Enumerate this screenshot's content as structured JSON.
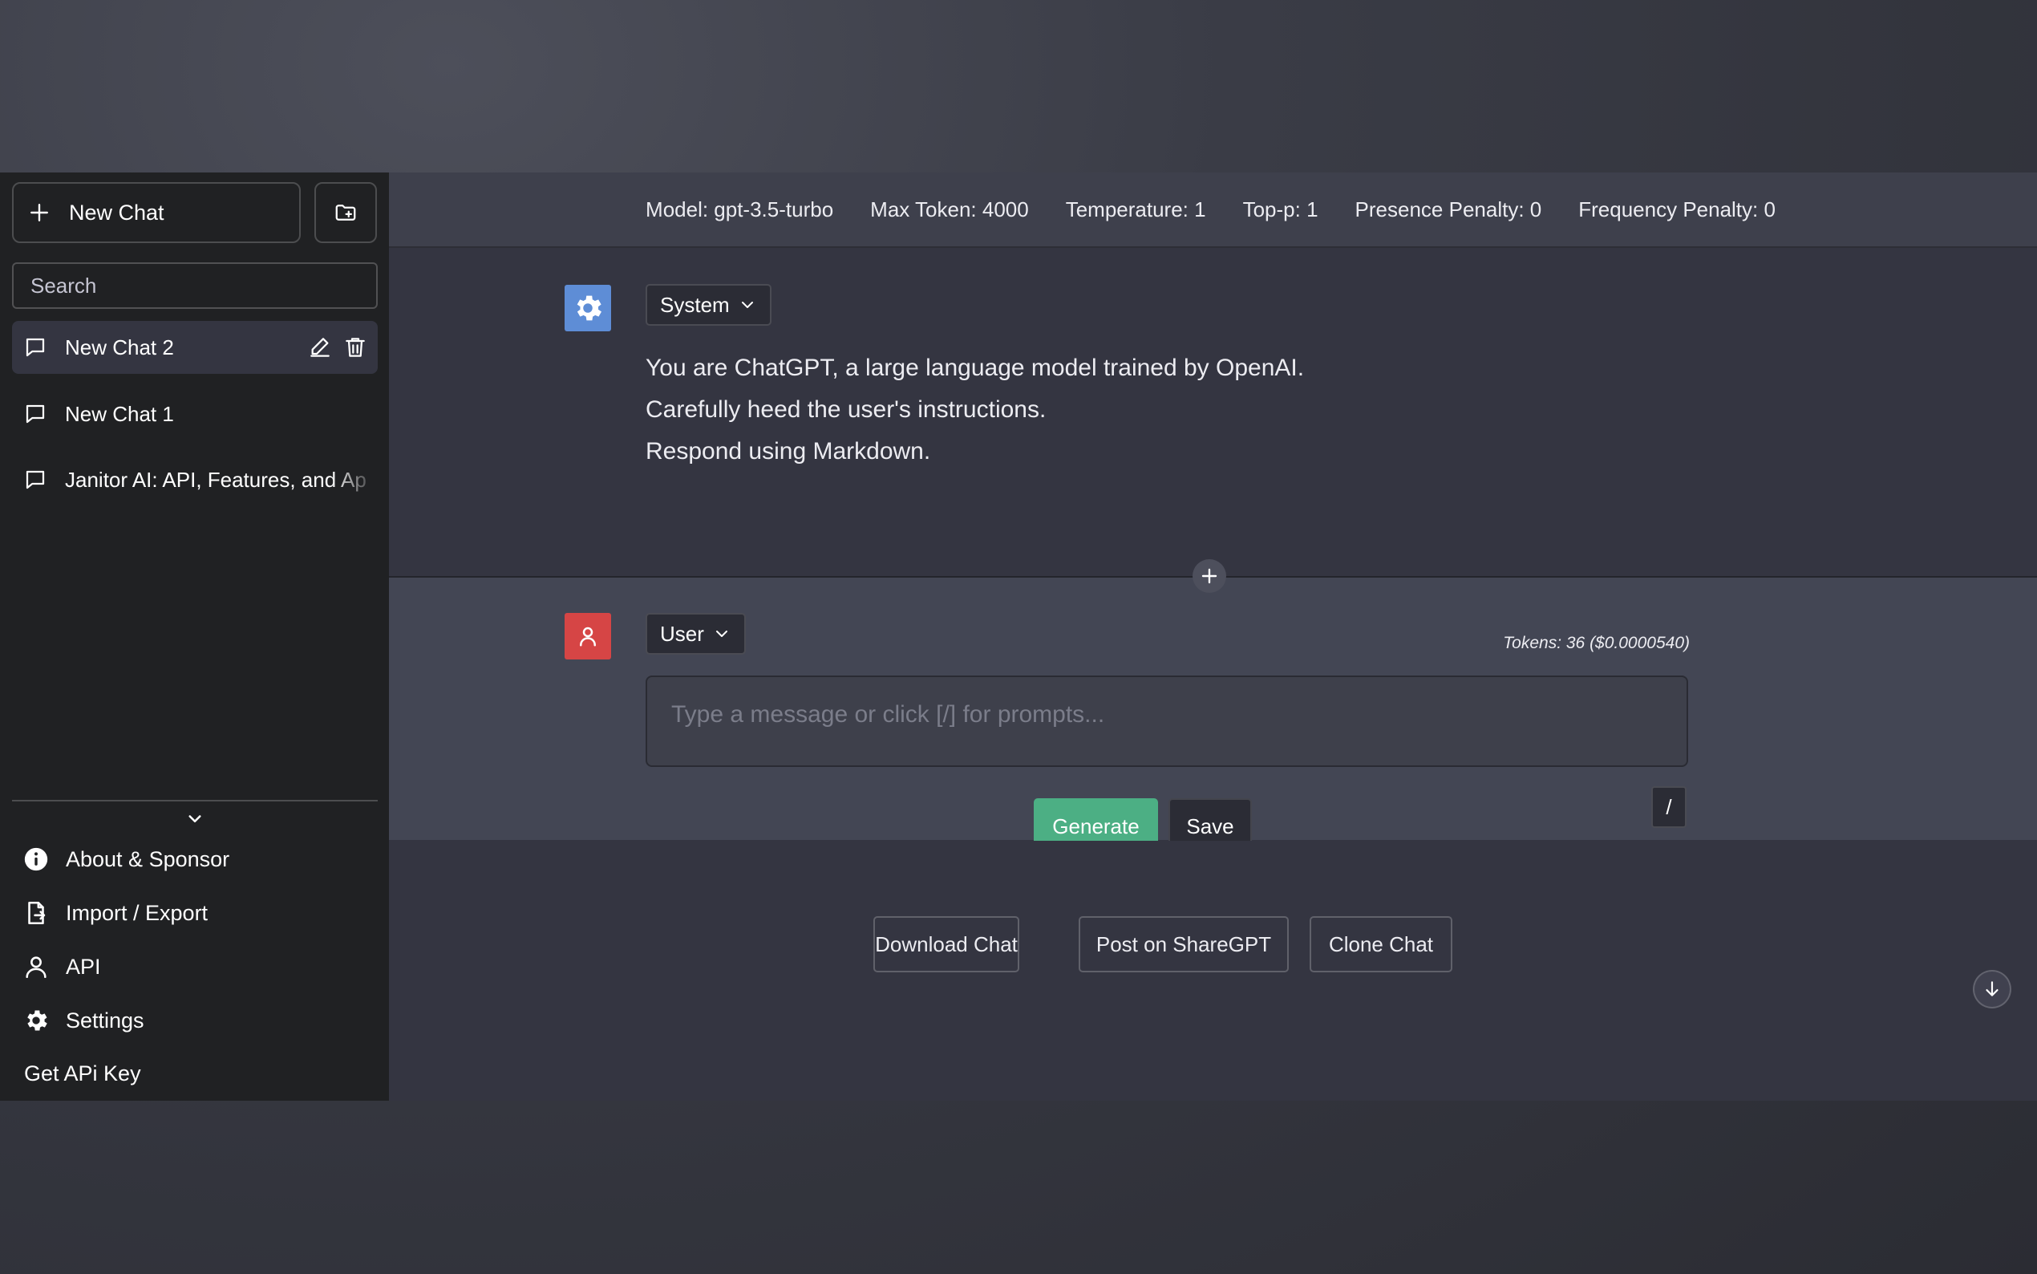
{
  "sidebar": {
    "new_chat_label": "New Chat",
    "new_folder_icon": "folder-plus-icon",
    "search_placeholder": "Search",
    "chats": [
      {
        "label": "New Chat 2",
        "active": true
      },
      {
        "label": "New Chat 1",
        "active": false
      },
      {
        "label": "Janitor AI: API, Features, and Ap",
        "active": false
      }
    ],
    "menu": [
      {
        "label": "About & Sponsor",
        "icon": "info-icon"
      },
      {
        "label": "Import / Export",
        "icon": "file-export-icon"
      },
      {
        "label": "API",
        "icon": "person-icon"
      },
      {
        "label": "Settings",
        "icon": "gear-icon"
      }
    ],
    "get_api_key_label": "Get APi Key"
  },
  "config": {
    "model": "Model: gpt-3.5-turbo",
    "max_token": "Max Token: 4000",
    "temperature": "Temperature: 1",
    "top_p": "Top-p: 1",
    "presence_penalty": "Presence Penalty: 0",
    "frequency_penalty": "Frequency Penalty: 0"
  },
  "system_message": {
    "role": "System",
    "lines": [
      "You are ChatGPT, a large language model trained by OpenAI.",
      "Carefully heed the user's instructions.",
      "Respond using Markdown."
    ]
  },
  "user_message": {
    "role": "User",
    "tokens": "Tokens: 36 ($0.0000540)",
    "placeholder": "Type a message or click [/] for prompts...",
    "generate_label": "Generate",
    "save_label": "Save",
    "prompt_shortcut_label": "/"
  },
  "actions": {
    "download_label": "Download Chat",
    "share_label": "Post on ShareGPT",
    "clone_label": "Clone Chat"
  },
  "colors": {
    "sidebar_bg": "#202123",
    "main_bg": "#343541",
    "user_block_bg": "#434654",
    "system_avatar": "#5e8dd6",
    "user_avatar": "#d64545",
    "generate_button": "#4caf84"
  }
}
